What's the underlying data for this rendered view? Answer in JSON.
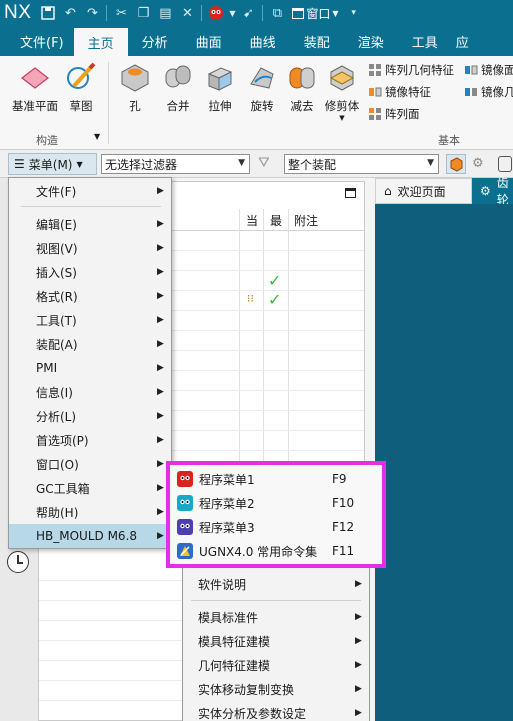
{
  "titlebar": {
    "app": "NX",
    "window_menu": "窗口"
  },
  "menubar": {
    "tabs": [
      "文件(F)",
      "主页",
      "分析",
      "曲面",
      "曲线",
      "装配",
      "渲染",
      "工具",
      "应"
    ],
    "active": "主页"
  },
  "ribbon": {
    "constructs": [
      {
        "label": "基准平面",
        "icon": "datum-plane-icon"
      },
      {
        "label": "草图",
        "icon": "sketch-icon"
      }
    ],
    "construct_group": "构造",
    "basics": [
      {
        "label": "孔",
        "icon": "hole-icon"
      },
      {
        "label": "合并",
        "icon": "unite-icon"
      },
      {
        "label": "拉伸",
        "icon": "extrude-icon"
      },
      {
        "label": "旋转",
        "icon": "revolve-icon"
      },
      {
        "label": "减去",
        "icon": "subtract-icon"
      },
      {
        "label": "修剪体",
        "icon": "trim-body-icon"
      }
    ],
    "small_col1": [
      "阵列几何特征",
      "镜像特征",
      "阵列面"
    ],
    "small_col2": [
      "镜像面",
      "镜像几"
    ],
    "basic_group": "基本"
  },
  "filterbar": {
    "menu_button": "菜单(M)",
    "filter_select": "无选择过滤器",
    "assembly_select": "整个装配"
  },
  "navigator": {
    "columns": [
      "当",
      "最",
      "附注"
    ]
  },
  "doctabs": {
    "home": "欢迎页面",
    "part": "齿轮"
  },
  "main_menu": {
    "items": [
      "文件(F)",
      "编辑(E)",
      "视图(V)",
      "插入(S)",
      "格式(R)",
      "工具(T)",
      "装配(A)",
      "PMI",
      "信息(I)",
      "分析(L)",
      "首选项(P)",
      "窗口(O)",
      "GC工具箱",
      "帮助(H)",
      "HB_MOULD M6.8"
    ]
  },
  "hb_submenu": {
    "items": [
      {
        "label": "程序菜单1",
        "shortcut": "F9",
        "icon": "yin-yang-red-icon",
        "color": "#d9231d"
      },
      {
        "label": "程序菜单2",
        "shortcut": "F10",
        "icon": "yin-yang-cyan-icon",
        "color": "#18a9c8"
      },
      {
        "label": "程序菜单3",
        "shortcut": "F12",
        "icon": "yin-yang-purple-icon",
        "color": "#4c3fb0"
      },
      {
        "label": "UGNX4.0 常用命令集",
        "shortcut": "F11",
        "icon": "ugnx-icon",
        "color": "#2f6cc9"
      }
    ]
  },
  "lower_menu": {
    "items": [
      "软件说明",
      "模具标准件",
      "模具特征建模",
      "几何特征建模",
      "实体移动复制变换",
      "实体分析及参数设定"
    ]
  },
  "highlight_color": "#e52ee5"
}
